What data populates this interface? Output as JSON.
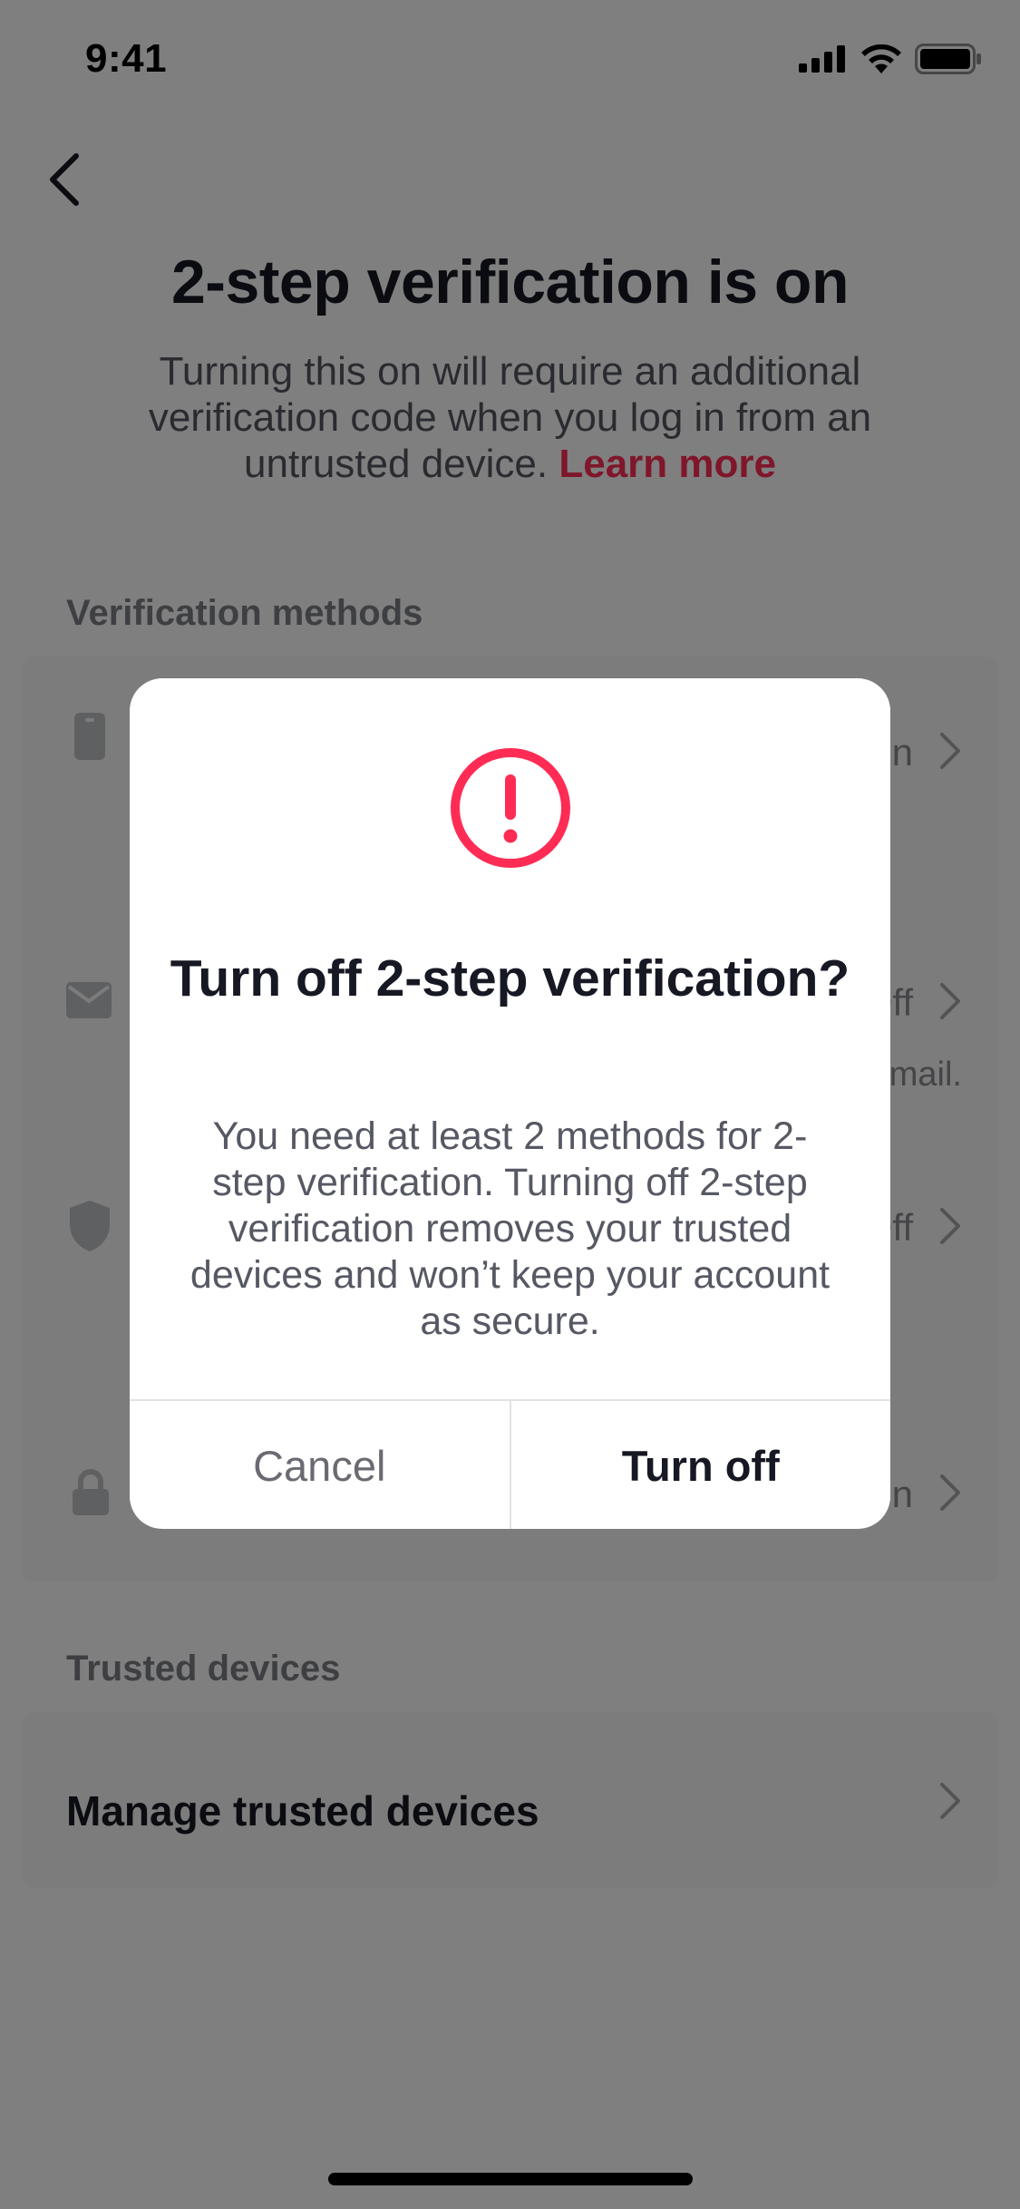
{
  "status_bar": {
    "time": "9:41"
  },
  "page": {
    "title": "2-step verification is on",
    "subtitle": "Turning this on will require an additional verification code when you log in from an untrusted device.",
    "learn_more": "Learn more"
  },
  "verification_methods": {
    "label": "Verification methods",
    "items": [
      {
        "icon": "phone-icon",
        "status": "On"
      },
      {
        "icon": "mail-icon",
        "status": "Off",
        "desc_tail": "email."
      },
      {
        "icon": "shield-icon",
        "status": "Off"
      },
      {
        "icon": "lock-icon",
        "status": "On"
      }
    ]
  },
  "trusted_devices": {
    "label": "Trusted devices",
    "manage": "Manage trusted devices"
  },
  "dialog": {
    "icon": "warning-icon",
    "title": "Turn off 2-step verification?",
    "body": "You need at least 2 methods for 2-step verification. Turning off 2-step verification removes your trusted devices and won’t keep your account as secure.",
    "cancel": "Cancel",
    "confirm": "Turn off"
  },
  "colors": {
    "accent": "#fe2c55",
    "overlay": "rgba(0,0,0,0.5)",
    "text_primary": "#161823"
  }
}
